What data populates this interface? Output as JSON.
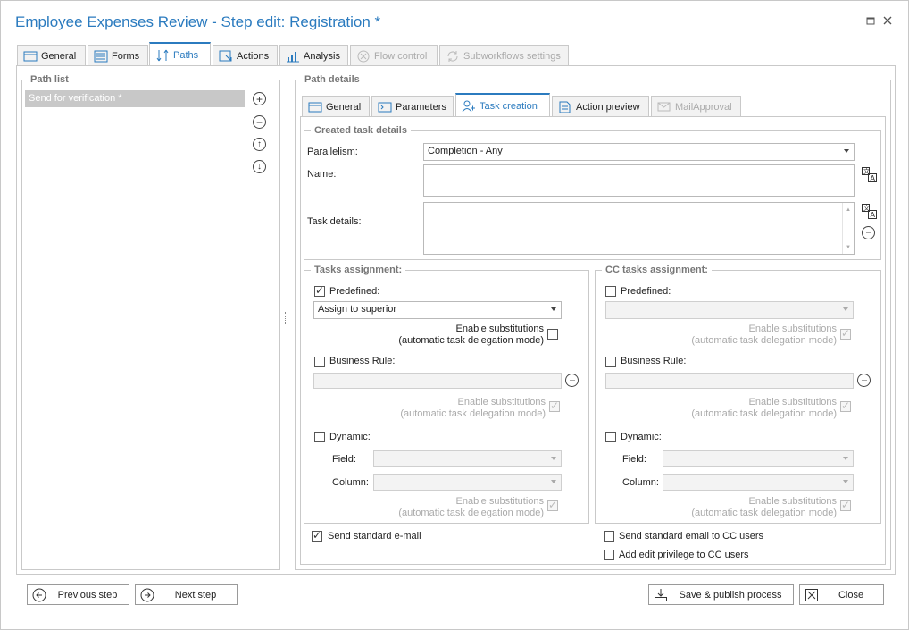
{
  "window": {
    "title": "Employee Expenses Review - Step edit: Registration *",
    "maximize_icon": "maximize-icon",
    "close_icon": "close-icon"
  },
  "main_tabs": [
    {
      "label": "General",
      "icon": "window-icon",
      "state": "normal"
    },
    {
      "label": "Forms",
      "icon": "form-icon",
      "state": "normal"
    },
    {
      "label": "Paths",
      "icon": "paths-icon",
      "state": "active"
    },
    {
      "label": "Actions",
      "icon": "actions-icon",
      "state": "normal"
    },
    {
      "label": "Analysis",
      "icon": "chart-icon",
      "state": "normal"
    },
    {
      "label": "Flow control",
      "icon": "flow-control-icon",
      "state": "disabled"
    },
    {
      "label": "Subworkflows settings",
      "icon": "refresh-icon",
      "state": "disabled"
    }
  ],
  "path_list": {
    "title": "Path list",
    "items": [
      "Send for verification *"
    ],
    "selected_index": 0
  },
  "path_details": {
    "title": "Path details",
    "tabs": [
      {
        "label": "General",
        "icon": "window-icon",
        "state": "normal"
      },
      {
        "label": "Parameters",
        "icon": "parameters-icon",
        "state": "normal"
      },
      {
        "label": "Task creation",
        "icon": "users-icon",
        "state": "active"
      },
      {
        "label": "Action preview",
        "icon": "document-icon",
        "state": "normal"
      },
      {
        "label": "MailApproval",
        "icon": "mail-icon",
        "state": "disabled"
      }
    ]
  },
  "created_task": {
    "title": "Created task details",
    "parallelism_label": "Parallelism:",
    "parallelism_value": "Completion - Any",
    "name_label": "Name:",
    "name_value": "",
    "details_label": "Task details:",
    "details_value": ""
  },
  "tasks_assignment": {
    "title": "Tasks assignment:",
    "predefined_label": "Predefined:",
    "predefined_checked": true,
    "predefined_value": "Assign to superior",
    "subst_line1": "Enable substitutions",
    "subst_line2": "(automatic task delegation mode)",
    "business_rule_label": "Business Rule:",
    "dynamic_label": "Dynamic:",
    "field_label": "Field:",
    "column_label": "Column:"
  },
  "cc_assignment": {
    "title": "CC tasks assignment:",
    "predefined_label": "Predefined:",
    "business_rule_label": "Business Rule:",
    "dynamic_label": "Dynamic:",
    "field_label": "Field:",
    "column_label": "Column:",
    "subst_line1": "Enable substitutions",
    "subst_line2": "(automatic task delegation mode)"
  },
  "footer_checks": {
    "send_email": "Send standard e-mail",
    "send_cc_email": "Send standard email to CC users",
    "add_edit_cc": "Add edit privilege to CC users"
  },
  "buttons": {
    "previous": "Previous step",
    "next": "Next step",
    "save_publish": "Save & publish process",
    "close": "Close"
  },
  "colors": {
    "accent": "#2b7bbf",
    "selection": "#c8c8c8",
    "border": "#c9c9c9"
  }
}
